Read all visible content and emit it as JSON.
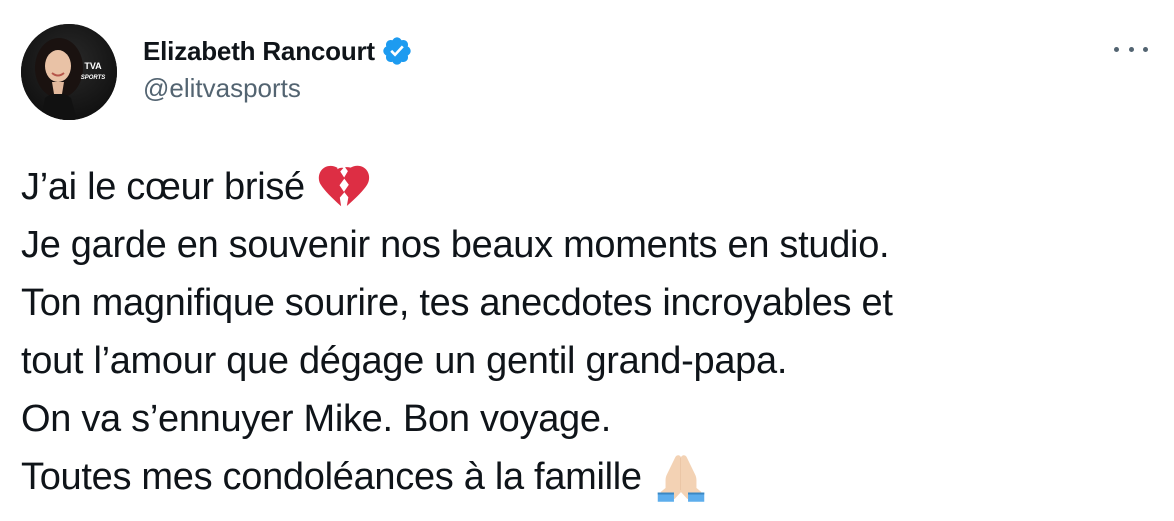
{
  "author": {
    "display_name": "Elizabeth Rancourt",
    "handle": "@elitvasports",
    "avatar_brand_text": "TVA SPORTS"
  },
  "tweet": {
    "lines": [
      "J’ai le cœur brisé",
      "Je garde en souvenir nos beaux moments en studio.",
      "Ton magnifique sourire, tes anecdotes incroyables et",
      "tout l’amour que dégage un gentil grand-papa.",
      "On va s’ennuyer Mike. Bon voyage.",
      "Toutes mes condoléances à la famille"
    ],
    "emojis": {
      "line_1": "broken-heart-icon",
      "line_6": "folded-hands-icon"
    }
  },
  "colors": {
    "text": "#0f1419",
    "secondary": "#536471",
    "verified": "#1d9bf0",
    "broken_heart": "#dd2e44"
  },
  "icons": {
    "verified": "verified-badge-icon",
    "more": "more-options-icon"
  }
}
